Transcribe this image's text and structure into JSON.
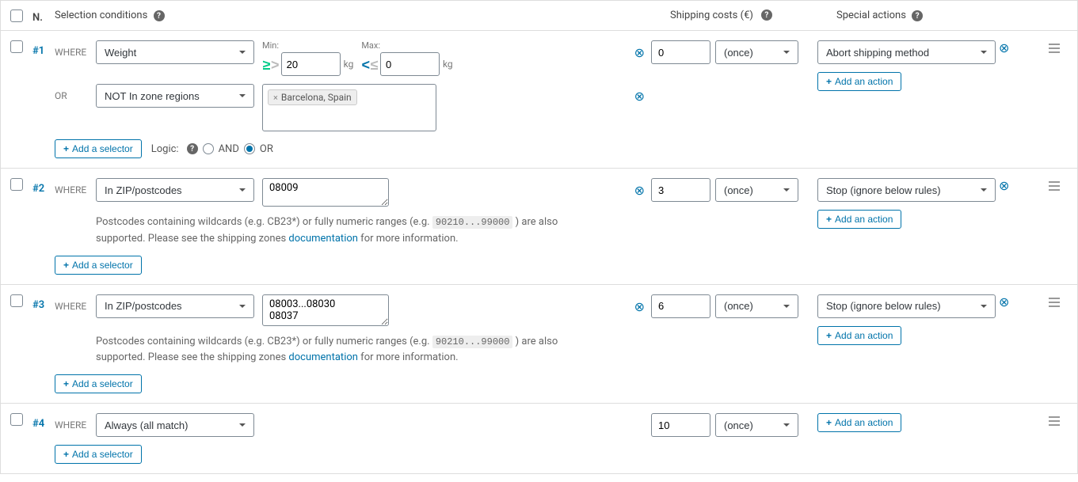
{
  "header": {
    "n": "N.",
    "selection_conditions": "Selection conditions",
    "shipping_costs": "Shipping costs (€)",
    "special_actions": "Special actions"
  },
  "labels": {
    "where": "WHERE",
    "or": "OR",
    "min": "Min:",
    "max": "Max:",
    "add_selector": "Add a selector",
    "add_action": "Add an action",
    "logic": "Logic:",
    "and": "AND",
    "or_opt": "OR",
    "kg": "kg",
    "documentation": "documentation"
  },
  "helper": {
    "part1": "Postcodes containing wildcards (e.g. CB23*) or fully numeric ranges (e.g. ",
    "code": "90210...99000",
    "part2": " ) are also supported. Please see the shipping zones ",
    "part3": " for more information."
  },
  "rules": [
    {
      "num": "#1",
      "selectors": [
        {
          "label": "WHERE",
          "type": "Weight",
          "min": "20",
          "max": "0",
          "kind": "weight"
        },
        {
          "label": "OR",
          "type": "NOT In zone regions",
          "tags": [
            "Barcelona, Spain"
          ],
          "kind": "regions"
        }
      ],
      "logic": "OR",
      "show_logic": true,
      "cost": "0",
      "freq": "(once)",
      "action": "Abort shipping method",
      "show_action_select": true
    },
    {
      "num": "#2",
      "selectors": [
        {
          "label": "WHERE",
          "type": "In ZIP/postcodes",
          "value": "08009",
          "kind": "zip"
        }
      ],
      "show_zip_help": true,
      "cost": "3",
      "freq": "(once)",
      "action": "Stop (ignore below rules)",
      "show_action_select": true
    },
    {
      "num": "#3",
      "selectors": [
        {
          "label": "WHERE",
          "type": "In ZIP/postcodes",
          "value": "08003...08030\n08037",
          "kind": "zip"
        }
      ],
      "show_zip_help": true,
      "cost": "6",
      "freq": "(once)",
      "action": "Stop (ignore below rules)",
      "show_action_select": true
    },
    {
      "num": "#4",
      "selectors": [
        {
          "label": "WHERE",
          "type": "Always (all match)",
          "kind": "always"
        }
      ],
      "cost": "10",
      "freq": "(once)",
      "show_action_select": false
    }
  ]
}
